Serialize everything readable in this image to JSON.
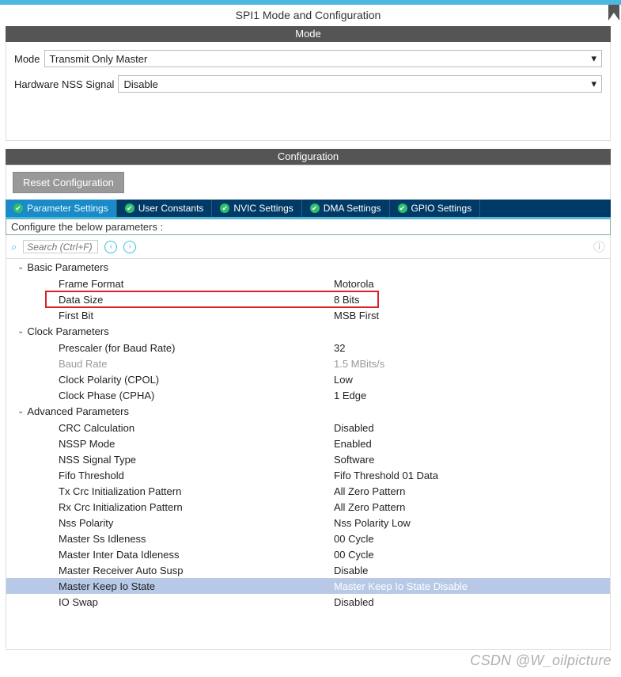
{
  "title": "SPI1 Mode and Configuration",
  "section_mode": "Mode",
  "section_config": "Configuration",
  "mode_form": {
    "mode_label": "Mode",
    "mode_value": "Transmit Only Master",
    "nss_label": "Hardware NSS Signal",
    "nss_value": "Disable"
  },
  "reset_label": "Reset Configuration",
  "tabs": {
    "param": "Parameter Settings",
    "user": "User Constants",
    "nvic": "NVIC Settings",
    "dma": "DMA Settings",
    "gpio": "GPIO Settings"
  },
  "configure_hint": "Configure the below parameters :",
  "search_placeholder": "Search (Ctrl+F)",
  "groups": [
    {
      "title": "Basic Parameters",
      "rows": [
        {
          "name": "Frame Format",
          "value": "Motorola"
        },
        {
          "name": "Data Size",
          "value": "8 Bits",
          "red": true
        },
        {
          "name": "First Bit",
          "value": "MSB First"
        }
      ]
    },
    {
      "title": "Clock Parameters",
      "rows": [
        {
          "name": "Prescaler (for Baud Rate)",
          "value": "32"
        },
        {
          "name": "Baud Rate",
          "value": "1.5 MBits/s",
          "disabled": true
        },
        {
          "name": "Clock Polarity (CPOL)",
          "value": "Low"
        },
        {
          "name": "Clock Phase (CPHA)",
          "value": "1 Edge"
        }
      ]
    },
    {
      "title": "Advanced Parameters",
      "rows": [
        {
          "name": "CRC Calculation",
          "value": "Disabled"
        },
        {
          "name": "NSSP Mode",
          "value": "Enabled"
        },
        {
          "name": "NSS Signal Type",
          "value": "Software"
        },
        {
          "name": "Fifo Threshold",
          "value": "Fifo Threshold 01 Data"
        },
        {
          "name": "Tx Crc Initialization Pattern",
          "value": "All Zero Pattern"
        },
        {
          "name": "Rx Crc Initialization Pattern",
          "value": "All Zero Pattern"
        },
        {
          "name": "Nss Polarity",
          "value": "Nss Polarity Low"
        },
        {
          "name": "Master Ss Idleness",
          "value": "00 Cycle"
        },
        {
          "name": "Master Inter Data Idleness",
          "value": "00 Cycle"
        },
        {
          "name": "Master Receiver Auto Susp",
          "value": "Disable"
        },
        {
          "name": "Master Keep Io State",
          "value": "Master Keep Io State Disable",
          "selected": true
        },
        {
          "name": "IO Swap",
          "value": "Disabled"
        }
      ]
    }
  ],
  "watermark": "CSDN @W_oilpicture"
}
